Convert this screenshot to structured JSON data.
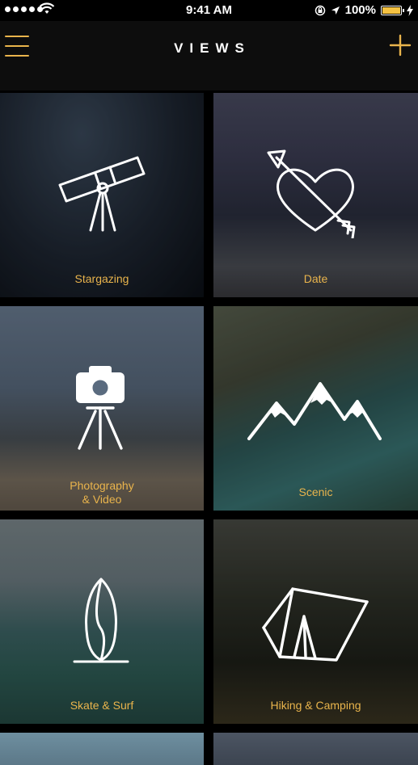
{
  "status_bar": {
    "time": "9:41 AM",
    "battery_percent": "100%",
    "battery_level": 1.0,
    "icons": [
      "signal-dots-icon",
      "wifi-icon",
      "orientation-lock-icon",
      "location-arrow-icon",
      "battery-icon",
      "charging-icon"
    ]
  },
  "nav": {
    "title": "VIEWS",
    "menu_icon": "hamburger-menu-icon",
    "add_icon": "plus-icon"
  },
  "colors": {
    "accent": "#e9b44c",
    "background": "#000000",
    "nav_background": "#0d0d0d"
  },
  "categories": [
    {
      "label": "Stargazing",
      "icon": "telescope-icon"
    },
    {
      "label": "Date",
      "icon": "heart-arrow-icon"
    },
    {
      "label": "Photography\n& Video",
      "icon": "camera-tripod-icon"
    },
    {
      "label": "Scenic",
      "icon": "mountains-icon"
    },
    {
      "label": "Skate & Surf",
      "icon": "surfboard-icon"
    },
    {
      "label": "Hiking & Camping",
      "icon": "tent-icon"
    }
  ]
}
